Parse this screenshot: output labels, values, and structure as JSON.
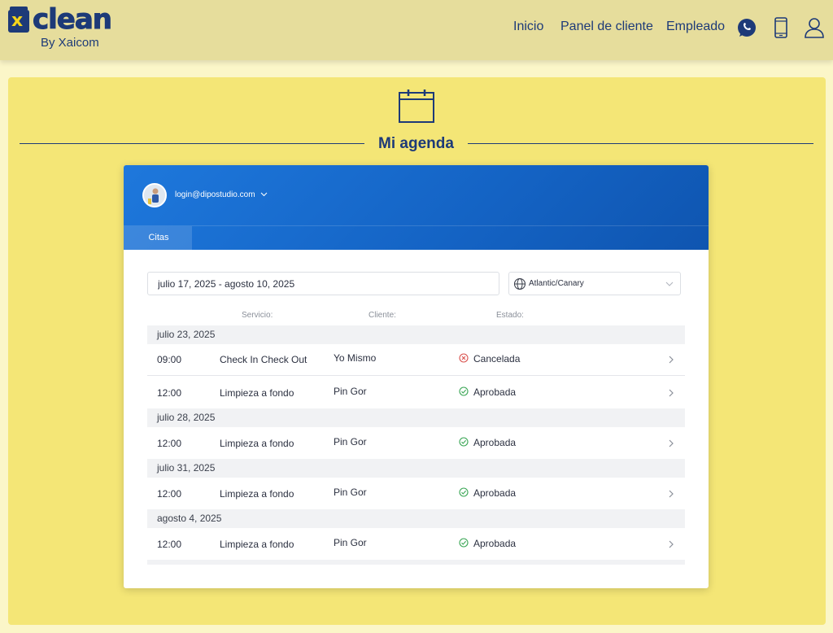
{
  "brand": {
    "logo_mark": "x",
    "logo_word": "clean",
    "tagline": "By Xaicom"
  },
  "nav": {
    "links": [
      "Inicio",
      "Panel de cliente",
      "Empleado"
    ],
    "icons": [
      "whatsapp-icon",
      "mobile-phone-icon",
      "user-icon"
    ]
  },
  "page": {
    "title": "Mi agenda",
    "icon": "calendar-icon"
  },
  "widget": {
    "user_email": "login@dipostudio.com",
    "tabs": [
      "Citas"
    ],
    "date_range": "julio 17, 2025 - agosto 10, 2025",
    "timezone": "Atlantic/Canary",
    "columns": [
      "Servicio:",
      "Cliente:",
      "Estado:"
    ],
    "groups": [
      {
        "date": "julio 23, 2025",
        "appointments": [
          {
            "time": "09:00",
            "service": "Check In Check Out",
            "client": "Yo Mismo",
            "status": "Cancelada",
            "status_type": "cancelled"
          },
          {
            "time": "12:00",
            "service": "Limpieza a fondo",
            "client": "Pin Gor",
            "status": "Aprobada",
            "status_type": "approved"
          }
        ]
      },
      {
        "date": "julio 28, 2025",
        "appointments": [
          {
            "time": "12:00",
            "service": "Limpieza a fondo",
            "client": "Pin Gor",
            "status": "Aprobada",
            "status_type": "approved"
          }
        ]
      },
      {
        "date": "julio 31, 2025",
        "appointments": [
          {
            "time": "12:00",
            "service": "Limpieza a fondo",
            "client": "Pin Gor",
            "status": "Aprobada",
            "status_type": "approved"
          }
        ]
      },
      {
        "date": "agosto 4, 2025",
        "appointments": [
          {
            "time": "12:00",
            "service": "Limpieza a fondo",
            "client": "Pin Gor",
            "status": "Aprobada",
            "status_type": "approved"
          }
        ]
      }
    ]
  },
  "colors": {
    "header_bg": "#e6dd9c",
    "panel_bg": "#f4e676",
    "brand_navy": "#1d3a78",
    "brand_yellow": "#f3d41c",
    "widget_header": "#1668cc",
    "approved": "#3aa655",
    "cancelled": "#d9534f"
  }
}
